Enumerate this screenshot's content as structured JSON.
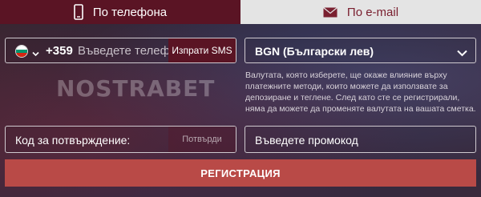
{
  "tabs": {
    "phone": {
      "label": "По телефона",
      "icon": "phone-icon",
      "active": true
    },
    "email": {
      "label": "По e-mail",
      "icon": "envelope-icon",
      "active": false
    }
  },
  "phone": {
    "country_flag": "bulgaria-flag-icon",
    "country_code": "+359",
    "placeholder": "Въведете телефон",
    "send_sms_label": "Изпрати SMS"
  },
  "currency": {
    "selected": "BGN (Български лев)",
    "note": "Валутата, която изберете, ще окаже влияние върху платежните методи, които можете да използвате за депозиране и теглене. След като сте се регистрирали, няма да можете да променяте валутата на вашата сметка."
  },
  "watermark": "NOSTRABET",
  "confirmation": {
    "label": "Код за потвърждение:",
    "confirm_label": "Потвърди"
  },
  "promo": {
    "placeholder": "Въведете промокод"
  },
  "register": {
    "label": "РЕГИСТРАЦИЯ"
  },
  "colors": {
    "active_tab": "#5a1424",
    "inactive_tab": "#e4e4e4",
    "register_button": "#b94a47"
  }
}
